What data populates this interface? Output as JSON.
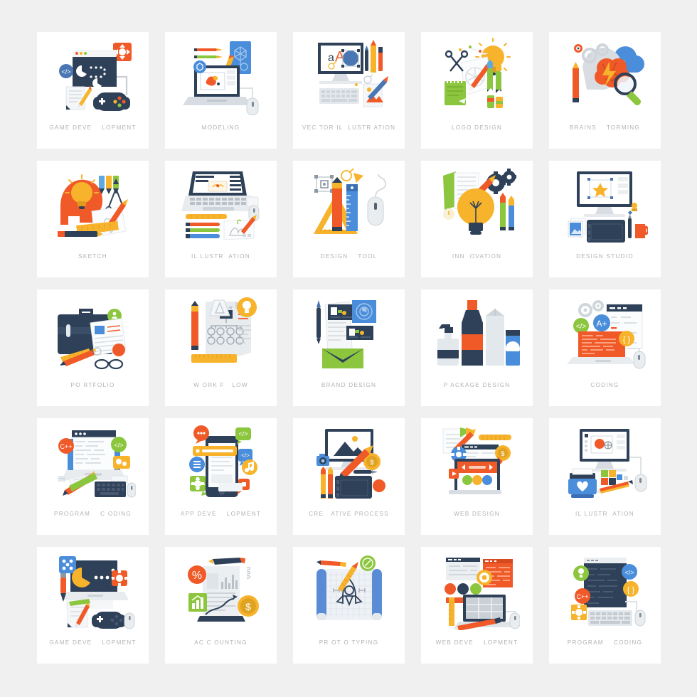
{
  "page": {
    "background_color": "#f0f0f0",
    "card_color": "#ffffff",
    "label_color": "#b3b3b3",
    "columns": 5,
    "rows": 5,
    "total_cards": 25
  },
  "palette": {
    "navy": "#2e4159",
    "dark_navy": "#28384d",
    "orange": "#f05a28",
    "red_orange": "#ef5b2b",
    "yellow": "#f7b32b",
    "gold": "#f5a623",
    "green": "#8cc63e",
    "blue": "#3a7bd5",
    "light_blue": "#6aa5e0",
    "steel_blue": "#4a77b4",
    "light_gray": "#e3e6e8",
    "mid_gray": "#c9ced3",
    "white": "#ffffff"
  },
  "cards": [
    {
      "id": "game-development-1",
      "label": "GAME DEVE    LOPMENT",
      "icon": "game-development-icon"
    },
    {
      "id": "modeling",
      "label": "MODELING",
      "icon": "modeling-icon"
    },
    {
      "id": "vector-illustration",
      "label": "VEC TOR IL  LUSTR ATION",
      "icon": "vector-illustration-icon"
    },
    {
      "id": "logo-design",
      "label": "LOGO DESIGN",
      "icon": "logo-design-icon"
    },
    {
      "id": "brainstorming",
      "label": "BRAINS    TORMING",
      "icon": "brainstorming-icon"
    },
    {
      "id": "sketch",
      "label": "SKETCH",
      "icon": "sketch-icon"
    },
    {
      "id": "illustration-1",
      "label": "IL LUSTR  ATION",
      "icon": "illustration-laptop-icon"
    },
    {
      "id": "design-tool",
      "label": "DESIGN    TOOL",
      "icon": "design-tool-icon"
    },
    {
      "id": "innovation",
      "label": "INN  OVATION",
      "icon": "innovation-icon"
    },
    {
      "id": "design-studio",
      "label": "DESIGN STUDIO",
      "icon": "design-studio-icon"
    },
    {
      "id": "portfolio",
      "label": "PO RTFOLIO",
      "icon": "portfolio-icon"
    },
    {
      "id": "workflow",
      "label": "W ORK F   LOW",
      "icon": "workflow-icon"
    },
    {
      "id": "brand-design",
      "label": "BRAND DESIGN",
      "icon": "brand-design-icon"
    },
    {
      "id": "package-design",
      "label": "P ACKAGE DESIGN",
      "icon": "package-design-icon"
    },
    {
      "id": "coding",
      "label": "CODING",
      "icon": "coding-icon"
    },
    {
      "id": "program-coding-1",
      "label": "PROGRAM    C ODING",
      "icon": "program-coding-icon"
    },
    {
      "id": "app-development",
      "label": "APP DEVE    LOPMENT",
      "icon": "app-development-icon"
    },
    {
      "id": "creative-process",
      "label": "CRE   ATIVE PROCESS",
      "icon": "creative-process-icon"
    },
    {
      "id": "web-design",
      "label": "WEB DESIGN",
      "icon": "web-design-icon"
    },
    {
      "id": "illustration-2",
      "label": "IL LUSTR  ATION",
      "icon": "illustration-printer-icon"
    },
    {
      "id": "game-development-2",
      "label": "GAME DEVE    LOPMENT",
      "icon": "game-development-2-icon"
    },
    {
      "id": "accounting",
      "label": "AC C OUNTING",
      "icon": "accounting-icon"
    },
    {
      "id": "prototyping",
      "label": "PR OT O TYPING",
      "icon": "prototyping-icon"
    },
    {
      "id": "web-development",
      "label": "WEB DEVE    LOPMENT",
      "icon": "web-development-icon"
    },
    {
      "id": "program-coding-2",
      "label": "PROGRAM    CODING",
      "icon": "program-coding-2-icon"
    }
  ]
}
